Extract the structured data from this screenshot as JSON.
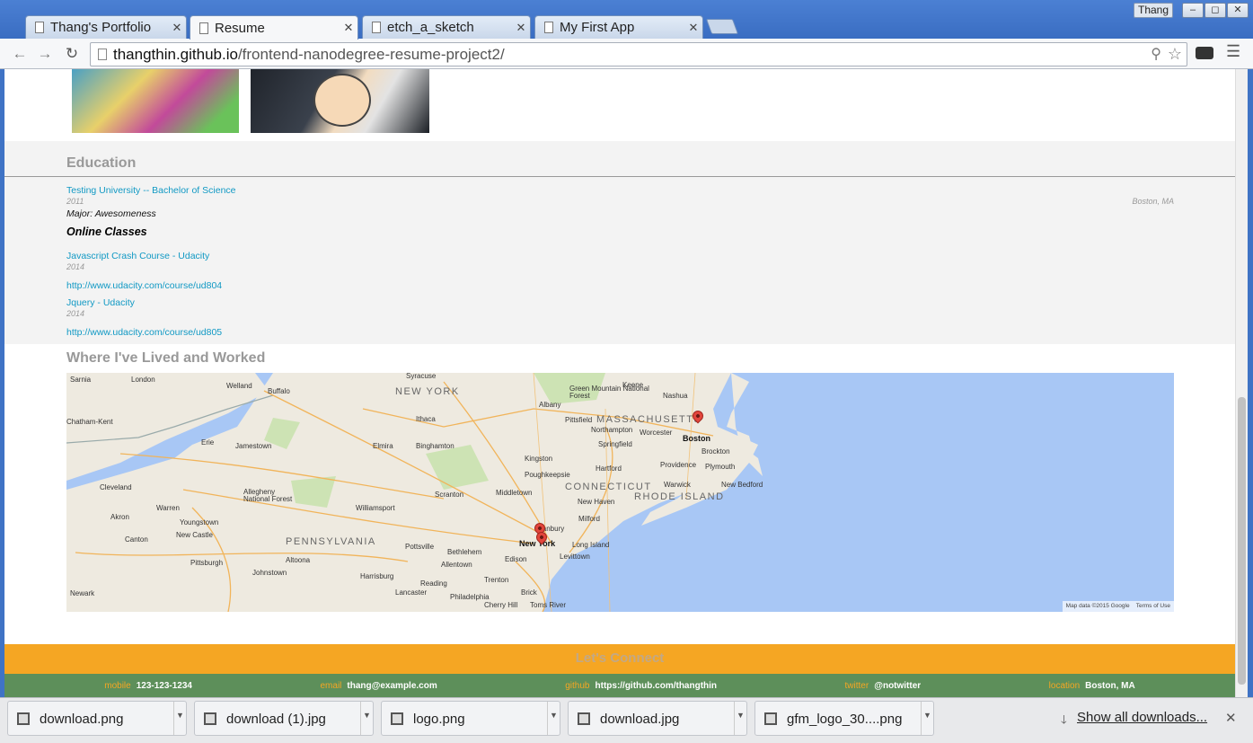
{
  "browser": {
    "tabs": [
      {
        "title": "Thang's Portfolio",
        "active": false
      },
      {
        "title": "Resume",
        "active": true
      },
      {
        "title": "etch_a_sketch",
        "active": false
      },
      {
        "title": "My First App",
        "active": false
      }
    ],
    "profile_name": "Thang",
    "url_host": "thangthin.github.io",
    "url_path": "/frontend-nanodegree-resume-project2/",
    "window_buttons": {
      "minimize": "–",
      "maximize": "◻",
      "close": "✕"
    }
  },
  "education": {
    "title": "Education",
    "schools": [
      {
        "name": "Testing University -- Bachelor of Science",
        "date": "2011",
        "location": "Boston, MA",
        "major": "Major: Awesomeness"
      }
    ],
    "online_heading": "Online Classes",
    "online_classes": [
      {
        "title": "Javascript Crash Course - Udacity",
        "date": "2014",
        "url": "http://www.udacity.com/course/ud804"
      },
      {
        "title": "Jquery - Udacity",
        "date": "2014",
        "url": "http://www.udacity.com/course/ud805"
      }
    ]
  },
  "map": {
    "title": "Where I've Lived and Worked",
    "states": [
      "NEW YORK",
      "MASSACHUSETTS",
      "CONNECTICUT",
      "RHODE ISLAND",
      "PENNSYLVANIA"
    ],
    "cities": [
      "Boston",
      "New York"
    ],
    "labels": [
      "Sarnia",
      "London",
      "Welland",
      "Buffalo",
      "Syracuse",
      "Albany",
      "Keene",
      "Nashua",
      "Chatham-Kent",
      "Erie",
      "Jamestown",
      "Elmira",
      "Binghamton",
      "Ithaca",
      "Pittsfield",
      "Northampton",
      "Worcester",
      "Springfield",
      "Brockton",
      "Providence",
      "Plymouth",
      "Cleveland",
      "Akron",
      "Youngstown",
      "Warren",
      "Canton",
      "New Castle",
      "Pittsburgh",
      "Johnstown",
      "Altoona",
      "Harrisburg",
      "Reading",
      "Lancaster",
      "Philadelphia",
      "Allentown",
      "Bethlehem",
      "Scranton",
      "Williamsport",
      "Pottsville",
      "Kingston",
      "Poughkeepsie",
      "Hartford",
      "New Haven",
      "Middletown",
      "Milford",
      "Danbury",
      "Edison",
      "Trenton",
      "Brick",
      "Toms River",
      "Cherry Hill",
      "Newark",
      "Levittown",
      "New Bedford",
      "Warwick",
      "Long Island",
      "Green Mountain National Forest",
      "Allegheny National Forest"
    ],
    "attribution": "Map data ©2015 Google",
    "terms": "Terms of Use"
  },
  "connect": {
    "title": "Let's Connect",
    "contacts": [
      {
        "key": "mobile",
        "value": "123-123-1234"
      },
      {
        "key": "email",
        "value": "thang@example.com"
      },
      {
        "key": "github",
        "value": "https://github.com/thangthin"
      },
      {
        "key": "twitter",
        "value": "@notwitter"
      },
      {
        "key": "location",
        "value": "Boston, MA"
      }
    ]
  },
  "downloads": {
    "items": [
      "download.png",
      "download (1).jpg",
      "logo.png",
      "download.jpg",
      "gfm_logo_30....png"
    ],
    "show_all": "Show all downloads...",
    "close": "✕"
  },
  "colors": {
    "chrome": "#3f73c5",
    "connect_bg": "#f5a623",
    "contacts_bg": "#5d8f5a",
    "link": "#1199c4",
    "map_water": "#a8c7f5"
  }
}
